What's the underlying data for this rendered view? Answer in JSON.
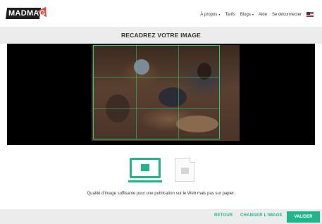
{
  "brand": {
    "logo_text": "MADMAG",
    "accent": "#20b58a",
    "logo_accent": "#e8473a"
  },
  "nav": {
    "items": [
      {
        "label": "À propos",
        "has_caret": true
      },
      {
        "label": "Tarifs",
        "has_caret": false
      },
      {
        "label": "Blogs",
        "has_caret": true
      },
      {
        "label": "Aide",
        "has_caret": false
      },
      {
        "label": "Se déconnecter",
        "has_caret": false
      }
    ],
    "language_icon": "us-flag-icon"
  },
  "page": {
    "title": "RECADREZ VOTRE IMAGE"
  },
  "cropper": {
    "image_icon": "photo-image",
    "crop_frame_color": "#2ecc71"
  },
  "quality": {
    "web_icon": "monitor-icon",
    "print_icon": "document-icon",
    "message": "Qualité d'image suffisante pour une publication sur le Web mais pas sur papier."
  },
  "footer": {
    "back_label": "RETOUR",
    "change_label": "CHANGER L'IMAGE",
    "validate_label": "VALIDER"
  }
}
